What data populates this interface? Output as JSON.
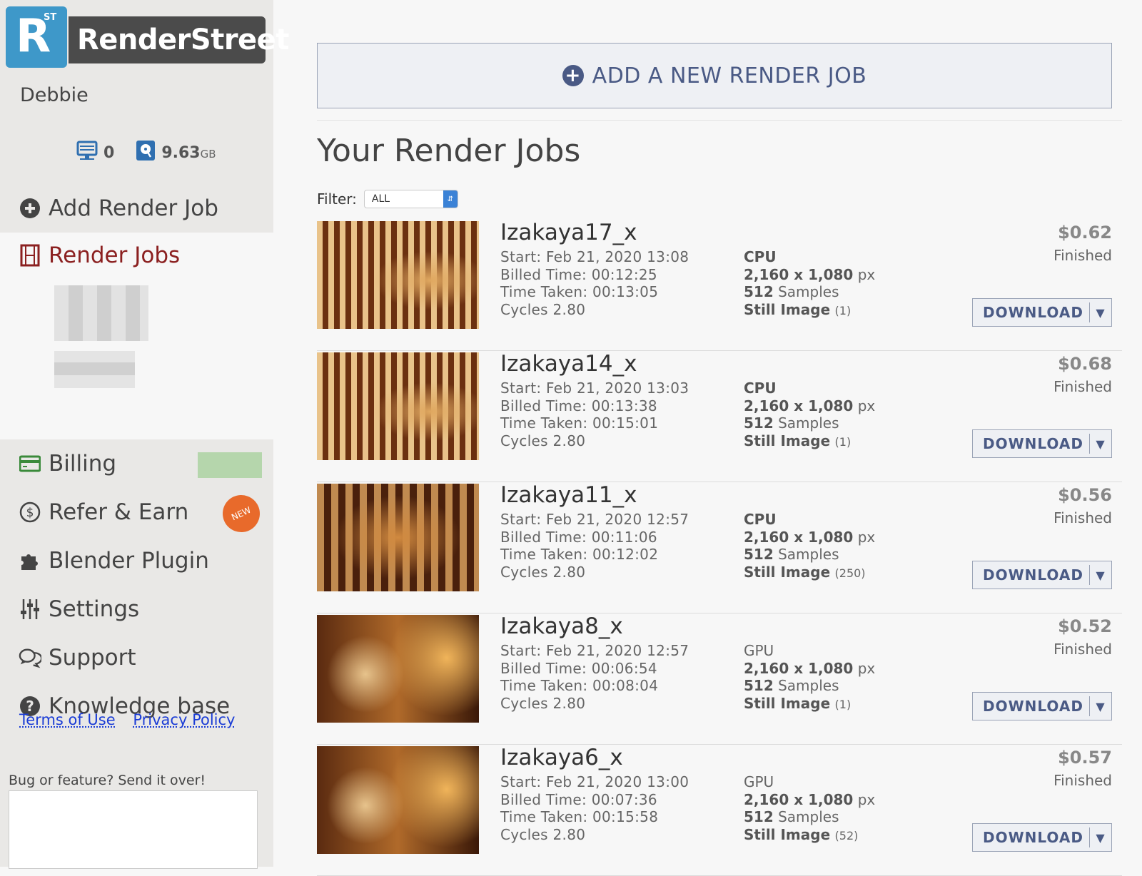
{
  "brand": {
    "badge_letter": "R",
    "badge_sup": "ST",
    "name": "RenderStreet"
  },
  "user": {
    "name": "Debbie"
  },
  "stats": {
    "queue_count": "0",
    "storage": "9.63",
    "storage_unit": "GB"
  },
  "nav": {
    "add_job": "Add Render Job",
    "render_jobs": "Render Jobs",
    "billing": "Billing",
    "refer": "Refer & Earn",
    "refer_badge": "NEW",
    "plugin": "Blender Plugin",
    "settings": "Settings",
    "support": "Support",
    "kb": "Knowledge base"
  },
  "footer": {
    "terms": "Terms of Use",
    "privacy": "Privacy Policy",
    "bug_label": "Bug or feature? Send it over!"
  },
  "main": {
    "add_button": "ADD A NEW RENDER JOB",
    "title": "Your Render Jobs",
    "filter_label": "Filter:",
    "filter_value": "ALL"
  },
  "jobs": [
    {
      "name": "Izakaya17_x",
      "start": "Start: Feb 21, 2020 13:08",
      "billed": "Billed Time: 00:12:25",
      "taken": "Time Taken: 00:13:05",
      "engine": "Cycles 2.80",
      "device": "CPU",
      "resolution": "2,160 x 1,080",
      "res_unit": "px",
      "samples": "512",
      "samples_label": "Samples",
      "type": "Still Image",
      "count": "(1)",
      "price": "$0.62",
      "status": "Finished",
      "download": "DOWNLOAD"
    },
    {
      "name": "Izakaya14_x",
      "start": "Start: Feb 21, 2020 13:03",
      "billed": "Billed Time: 00:13:38",
      "taken": "Time Taken: 00:15:01",
      "engine": "Cycles 2.80",
      "device": "CPU",
      "resolution": "2,160 x 1,080",
      "res_unit": "px",
      "samples": "512",
      "samples_label": "Samples",
      "type": "Still Image",
      "count": "(1)",
      "price": "$0.68",
      "status": "Finished",
      "download": "DOWNLOAD"
    },
    {
      "name": "Izakaya11_x",
      "start": "Start: Feb 21, 2020 12:57",
      "billed": "Billed Time: 00:11:06",
      "taken": "Time Taken: 00:12:02",
      "engine": "Cycles 2.80",
      "device": "CPU",
      "resolution": "2,160 x 1,080",
      "res_unit": "px",
      "samples": "512",
      "samples_label": "Samples",
      "type": "Still Image",
      "count": "(250)",
      "price": "$0.56",
      "status": "Finished",
      "download": "DOWNLOAD"
    },
    {
      "name": "Izakaya8_x",
      "start": "Start: Feb 21, 2020 12:57",
      "billed": "Billed Time: 00:06:54",
      "taken": "Time Taken: 00:08:04",
      "engine": "Cycles 2.80",
      "device": "GPU",
      "resolution": "2,160 x 1,080",
      "res_unit": "px",
      "samples": "512",
      "samples_label": "Samples",
      "type": "Still Image",
      "count": "(1)",
      "price": "$0.52",
      "status": "Finished",
      "download": "DOWNLOAD"
    },
    {
      "name": "Izakaya6_x",
      "start": "Start: Feb 21, 2020 13:00",
      "billed": "Billed Time: 00:07:36",
      "taken": "Time Taken: 00:15:58",
      "engine": "Cycles 2.80",
      "device": "GPU",
      "resolution": "2,160 x 1,080",
      "res_unit": "px",
      "samples": "512",
      "samples_label": "Samples",
      "type": "Still Image",
      "count": "(52)",
      "price": "$0.57",
      "status": "Finished",
      "download": "DOWNLOAD"
    }
  ]
}
